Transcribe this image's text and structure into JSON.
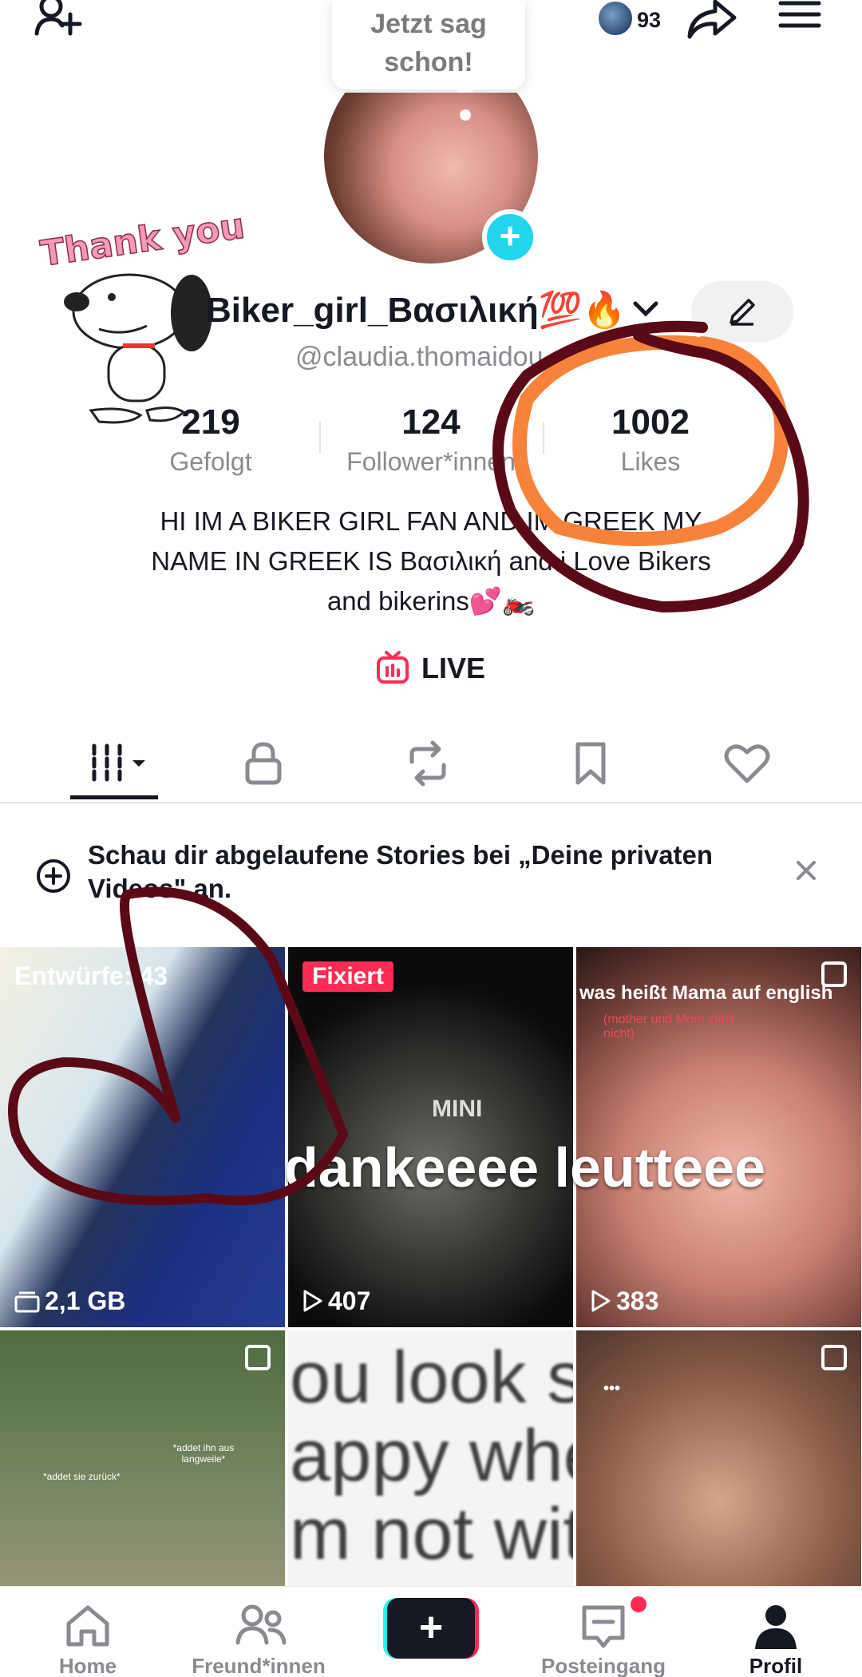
{
  "header": {
    "tooltip_text": "Jetzt sag schon!",
    "mini_count": "93",
    "icons": [
      "add-user-icon",
      "share-icon",
      "menu-icon"
    ]
  },
  "sticker": {
    "text": "Thank you"
  },
  "profile": {
    "display_name": "Biker_girl_Βασιλική💯🔥",
    "handle": "@claudia.thomaidou",
    "stats": [
      {
        "value": "219",
        "label": "Gefolgt"
      },
      {
        "value": "124",
        "label": "Follower*innen"
      },
      {
        "value": "1002",
        "label": "Likes"
      }
    ],
    "bio_lines": [
      "HI IM A BIKER GIRL FAN AND IM GREEK MY",
      "NAME IN GREEK IS Βασιλική and i Love Bikers",
      "and bikerins💕🏍️"
    ],
    "live_label": "LIVE"
  },
  "tabs": [
    "videos-grid-tab",
    "private-tab",
    "reposts-tab",
    "saved-tab",
    "liked-tab"
  ],
  "notice": {
    "text": "Schau dir abgelaufene Stories bei „Deine privaten Videos\" an."
  },
  "grid": {
    "overlay_text": "dankeeee leutteee",
    "cells": [
      {
        "caption": "Entwürfe: 43",
        "footer": "2,1 GB"
      },
      {
        "badge": "Fixiert",
        "inner_text": "MINI",
        "views": "407"
      },
      {
        "caption": "was heißt Mama auf english",
        "subcaption": "(mother und Mom zählt nicht)",
        "views": "383"
      },
      {
        "tag_left": "*addet sie zurück*",
        "tag_right": "*addet ihn aus langweile*"
      },
      {
        "lines": [
          "ou  look  s",
          "appy whe",
          "m  not  wit"
        ]
      },
      {
        "dots": "•••"
      }
    ]
  },
  "bottom_nav": [
    {
      "label": "Home"
    },
    {
      "label": "Freund*innen"
    },
    {
      "label": ""
    },
    {
      "label": "Posteingang"
    },
    {
      "label": "Profil"
    }
  ],
  "colors": {
    "accent_pink": "#fe2c55",
    "accent_cyan": "#25f4ee",
    "scribble_dark": "#5a0a16",
    "scribble_orange": "#f7833a"
  }
}
